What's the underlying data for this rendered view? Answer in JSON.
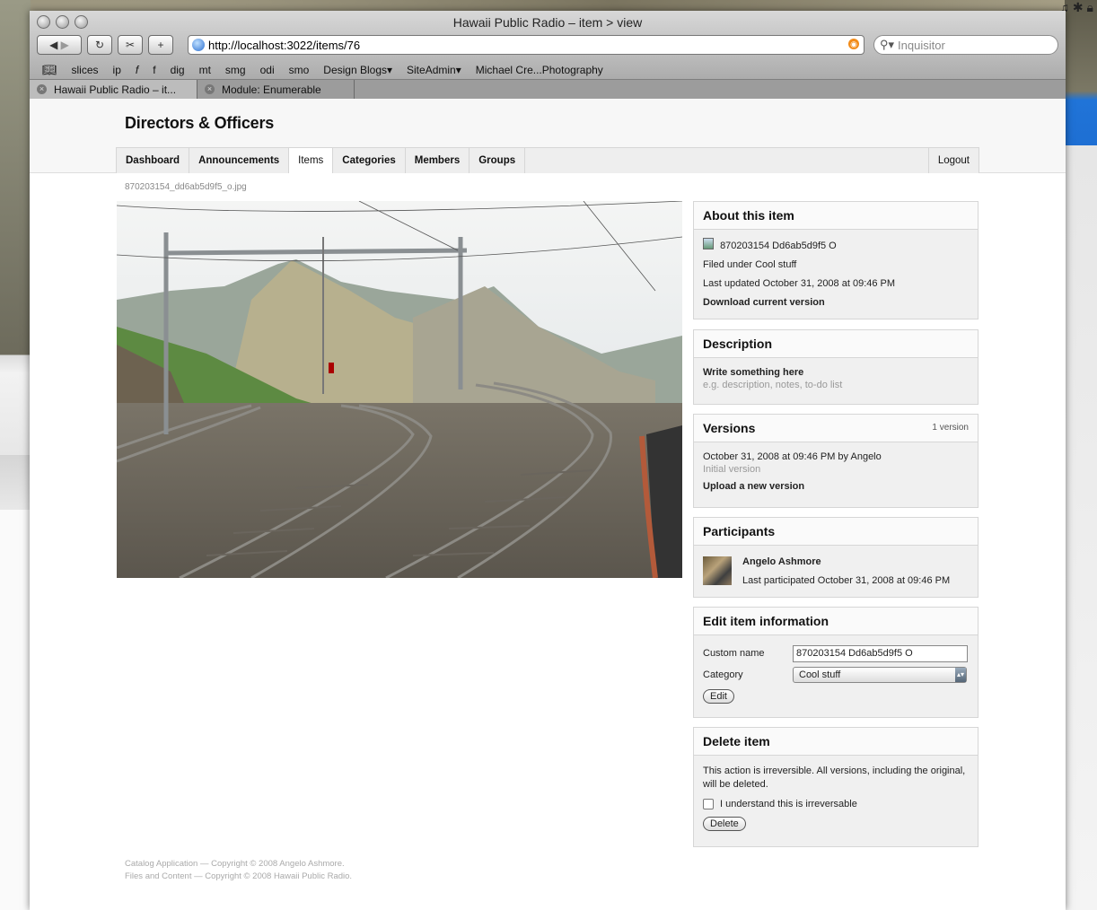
{
  "window": {
    "title": "Hawaii Public Radio – item > view"
  },
  "browser": {
    "url": "http://localhost:3022/items/76",
    "search_placeholder": "Inquisitor",
    "bookmarks": [
      "slices",
      "ip",
      "f",
      "f",
      "dig",
      "mt",
      "smg",
      "odi",
      "smo",
      "Design Blogs▾",
      "SiteAdmin▾",
      "Michael Cre...Photography"
    ],
    "tabs": [
      {
        "label": "Hawaii Public Radio – it...",
        "active": true
      },
      {
        "label": "Module: Enumerable",
        "active": false
      }
    ]
  },
  "site": {
    "title": "Directors & Officers",
    "nav": [
      "Dashboard",
      "Announcements",
      "Items",
      "Categories",
      "Members",
      "Groups"
    ],
    "nav_active": "Items",
    "logout": "Logout"
  },
  "item": {
    "filename": "870203154_dd6ab5d9f5_o.jpg"
  },
  "about": {
    "heading": "About this item",
    "name": "870203154 Dd6ab5d9f5 O",
    "filed": "Filed under Cool stuff",
    "updated": "Last updated October 31, 2008 at 09:46 PM",
    "download": "Download current version"
  },
  "description": {
    "heading": "Description",
    "prompt": "Write something here",
    "hint": "e.g. description, notes, to-do list"
  },
  "versions": {
    "heading": "Versions",
    "count": "1 version",
    "entry": "October 31, 2008 at 09:46 PM by Angelo",
    "entry_note": "Initial version",
    "upload": "Upload a new version"
  },
  "participants": {
    "heading": "Participants",
    "name": "Angelo Ashmore",
    "last": "Last participated October 31, 2008 at 09:46 PM"
  },
  "edit": {
    "heading": "Edit item information",
    "custom_name_label": "Custom name",
    "custom_name_value": "870203154 Dd6ab5d9f5 O",
    "category_label": "Category",
    "category_value": "Cool stuff",
    "button": "Edit"
  },
  "delete": {
    "heading": "Delete item",
    "warning": "This action is irreversible. All versions, including the original, will be deleted.",
    "confirm": "I understand this is irreversable",
    "button": "Delete"
  },
  "footer": {
    "line1": "Catalog Application — Copyright © 2008 Angelo Ashmore.",
    "line2": "Files and Content — Copyright © 2008 Hawaii Public Radio."
  }
}
